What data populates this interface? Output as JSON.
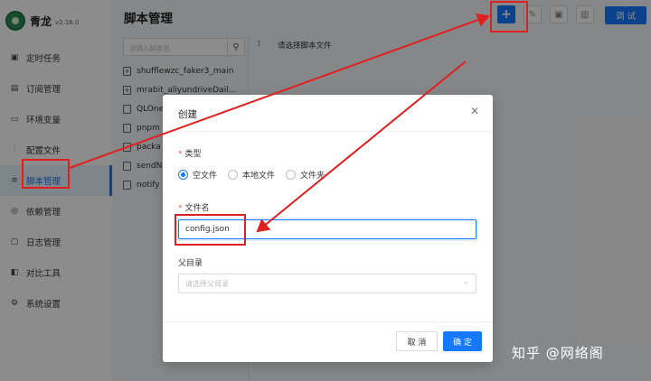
{
  "app": {
    "brand": "青龙",
    "version": "v2.16.0",
    "page_title": "脚本管理"
  },
  "sidebar": {
    "items": [
      {
        "label": "定时任务",
        "icon": "calendar-icon"
      },
      {
        "label": "订阅管理",
        "icon": "subscribe-icon"
      },
      {
        "label": "环境变量",
        "icon": "monitor-icon"
      },
      {
        "label": "配置文件",
        "icon": "sliders-icon"
      },
      {
        "label": "脚本管理",
        "icon": "file-code-icon",
        "active": true
      },
      {
        "label": "依赖管理",
        "icon": "dependency-icon"
      },
      {
        "label": "日志管理",
        "icon": "log-icon"
      },
      {
        "label": "对比工具",
        "icon": "diff-icon"
      },
      {
        "label": "系统设置",
        "icon": "gear-icon"
      }
    ]
  },
  "toolbar": {
    "add_label": "+",
    "debug_label": "调 试"
  },
  "tree": {
    "search_placeholder": "请输入脚本名",
    "items": [
      {
        "name": "shufflewzc_faker3_main",
        "type": "folder"
      },
      {
        "name": "mrabit_aliyundriveDail...",
        "type": "folder"
      },
      {
        "name": "QLOne",
        "type": "file"
      },
      {
        "name": "pnpm",
        "type": "file"
      },
      {
        "name": "packa",
        "type": "file"
      },
      {
        "name": "sendN",
        "type": "file"
      },
      {
        "name": "notify",
        "type": "file"
      }
    ]
  },
  "editor": {
    "line_number": "1",
    "line_text": "请选择脚本文件"
  },
  "modal": {
    "title": "创建",
    "type_label": "类型",
    "type_options": [
      "空文件",
      "本地文件",
      "文件夹"
    ],
    "type_selected": "空文件",
    "filename_label": "文件名",
    "filename_value": "config.json",
    "parent_label": "父目录",
    "parent_placeholder": "请选择父目录",
    "cancel_label": "取 消",
    "ok_label": "确 定"
  },
  "watermark": "知乎 @网络阁",
  "colors": {
    "primary": "#1677ff",
    "annotation": "#e02020",
    "required": "#ff4d4f"
  }
}
